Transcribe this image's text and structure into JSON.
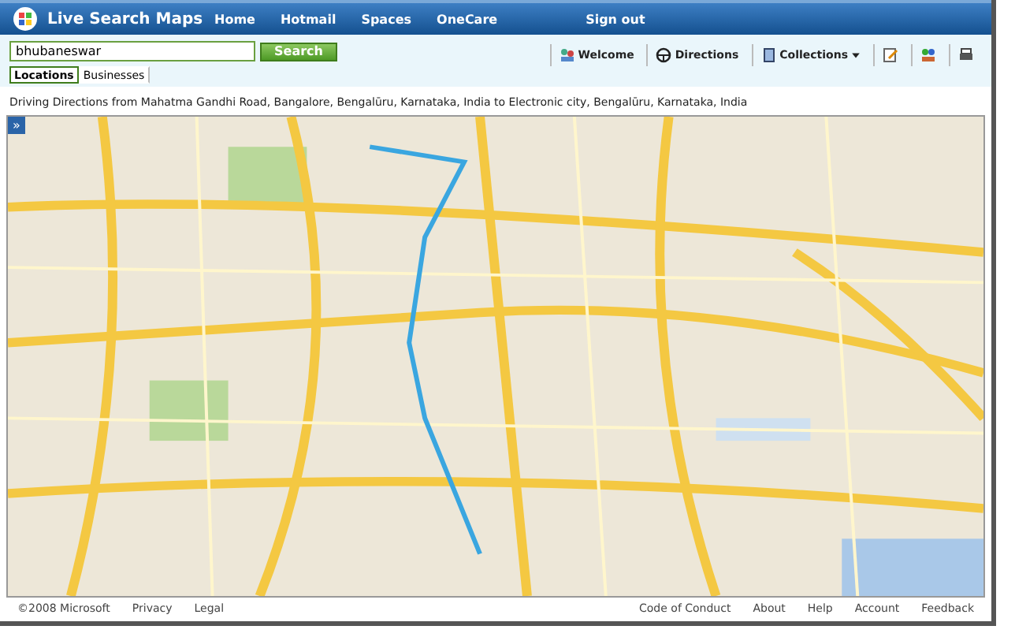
{
  "header": {
    "brand": "Live Search Maps",
    "nav": [
      "Home",
      "Hotmail",
      "Spaces",
      "OneCare",
      "Sign out"
    ]
  },
  "search": {
    "value": "bhubaneswar",
    "button": "Search"
  },
  "tabs": [
    {
      "label": "Locations",
      "selected": true
    },
    {
      "label": "Businesses",
      "selected": false
    }
  ],
  "toolbar": [
    {
      "label": "Welcome",
      "kind": "welcome"
    },
    {
      "label": "Directions",
      "kind": "directions"
    },
    {
      "label": "Collections",
      "kind": "collections"
    }
  ],
  "directions_title": "Driving Directions from Mahatma Gandhi Road, Bangalore, Bengalūru, Karnataka, India to Electronic city, Bengalūru, Karnataka, India",
  "map": {
    "panel_toggle": "»"
  },
  "footer": {
    "left": [
      "©2008 Microsoft",
      "Privacy",
      "Legal"
    ],
    "right": [
      "Code of Conduct",
      "About",
      "Help",
      "Account",
      "Feedback"
    ]
  }
}
